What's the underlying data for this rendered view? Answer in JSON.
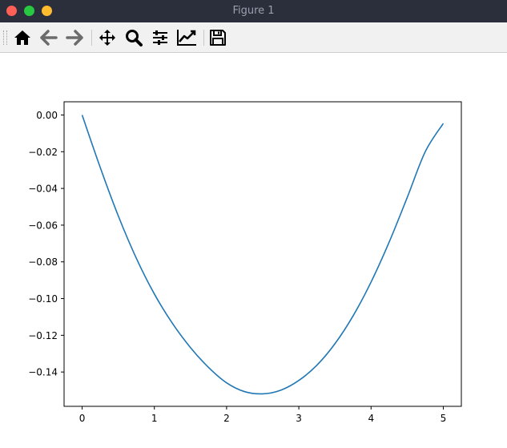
{
  "window": {
    "title": "Figure 1"
  },
  "toolbar": {
    "buttons": [
      {
        "name": "home-icon"
      },
      {
        "name": "back-arrow-icon"
      },
      {
        "name": "forward-arrow-icon"
      },
      {
        "name": "pan-icon"
      },
      {
        "name": "zoom-icon"
      },
      {
        "name": "configure-subplots-icon"
      },
      {
        "name": "edit-axis-icon"
      },
      {
        "name": "save-icon"
      }
    ]
  },
  "chart_data": {
    "type": "line",
    "title": "",
    "xlabel": "",
    "ylabel": "",
    "xlim": [
      -0.25,
      5.25
    ],
    "ylim": [
      -0.1587,
      0.0072
    ],
    "xticks": [
      0,
      1,
      2,
      3,
      4,
      5
    ],
    "yticks": [
      0.0,
      -0.02,
      -0.04,
      -0.06,
      -0.08,
      -0.1,
      -0.12,
      -0.14
    ],
    "ytick_labels": [
      "0.00",
      "−0.02",
      "−0.04",
      "−0.06",
      "−0.08",
      "−0.10",
      "−0.12",
      "−0.14"
    ],
    "xtick_labels": [
      "0",
      "1",
      "2",
      "3",
      "4",
      "5"
    ],
    "grid": false,
    "series": [
      {
        "color": "#1f77b4",
        "x": [
          0,
          0.25,
          0.5,
          0.75,
          1.0,
          1.25,
          1.5,
          1.75,
          2.0,
          2.25,
          2.5,
          2.75,
          3.0,
          3.25,
          3.5,
          3.75,
          4.0,
          4.25,
          4.5,
          4.75,
          5.0
        ],
        "y": [
          0.0,
          -0.0285,
          -0.0549,
          -0.078,
          -0.0975,
          -0.1135,
          -0.1267,
          -0.1375,
          -0.1459,
          -0.1507,
          -0.1519,
          -0.1499,
          -0.1446,
          -0.1363,
          -0.1246,
          -0.1095,
          -0.091,
          -0.0693,
          -0.045,
          -0.02,
          -0.0046
        ]
      }
    ]
  }
}
